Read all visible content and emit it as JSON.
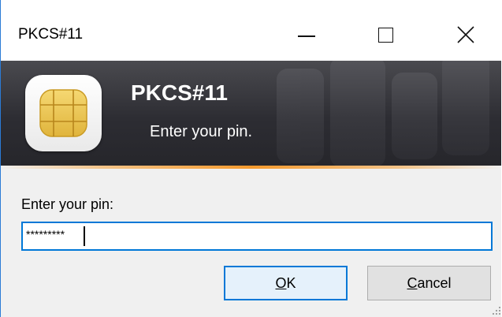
{
  "window": {
    "title": "PKCS#11",
    "controls": {
      "minimize": "minimize-icon",
      "maximize": "maximize-icon",
      "close": "close-icon"
    }
  },
  "banner": {
    "title": "PKCS#11",
    "subtitle": "Enter your pin.",
    "icon": "smartcard-chip-icon",
    "accent_color": "#f49a2e"
  },
  "form": {
    "pin_label": "Enter your pin:",
    "pin_value": "*********"
  },
  "buttons": {
    "ok_label_mnemonic": "O",
    "ok_label_rest": "K",
    "cancel_label_mnemonic": "C",
    "cancel_label_rest": "ancel"
  },
  "colors": {
    "focus_border": "#0078d7",
    "window_border": "#2b7bd6"
  }
}
